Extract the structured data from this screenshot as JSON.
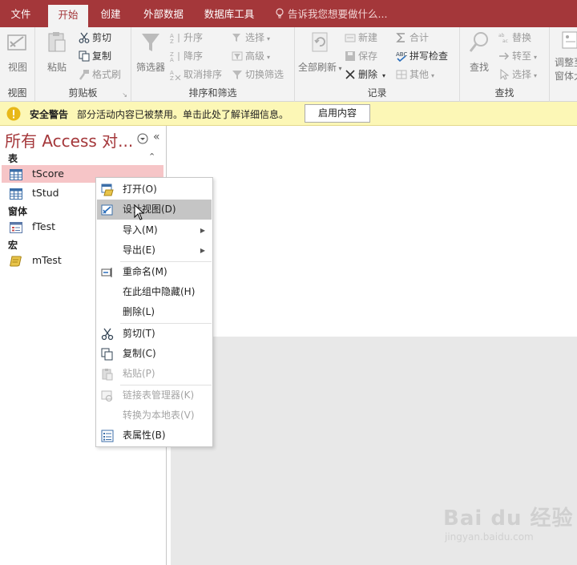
{
  "tabs": [
    "文件",
    "开始",
    "创建",
    "外部数据",
    "数据库工具"
  ],
  "tell_me": "告诉我您想要做什么...",
  "ribbon": {
    "views": {
      "view": "视图",
      "group": "视图"
    },
    "clipboard": {
      "paste": "粘贴",
      "cut": "剪切",
      "copy": "复制",
      "format_painter": "格式刷",
      "group": "剪贴板"
    },
    "sort": {
      "filter": "筛选器",
      "asc": "升序",
      "desc": "降序",
      "remove_sort": "取消排序",
      "selection": "选择",
      "advanced": "高级",
      "toggle_filter": "切换筛选",
      "group": "排序和筛选"
    },
    "records": {
      "refresh_all": "全部刷新",
      "new": "新建",
      "save": "保存",
      "delete": "删除",
      "totals": "合计",
      "spelling": "拼写检查",
      "more": "其他",
      "group": "记录"
    },
    "find": {
      "find": "查找",
      "replace": "替换",
      "goto": "转至",
      "select": "选择",
      "group": "查找"
    },
    "window": {
      "size_line1": "调整至",
      "size_line2": "窗体大小"
    }
  },
  "security": {
    "title": "安全警告",
    "message": "部分活动内容已被禁用。单击此处了解详细信息。",
    "button": "启用内容"
  },
  "nav": {
    "title": "所有 Access 对...",
    "groups": {
      "tables": "表",
      "forms": "窗体",
      "macros": "宏"
    },
    "items": {
      "tScore": "tScore",
      "tStud": "tStud",
      "fTest": "fTest",
      "mTest": "mTest"
    }
  },
  "context_menu": {
    "open": "打开(O)",
    "design_view": "设计视图(D)",
    "import": "导入(M)",
    "export": "导出(E)",
    "rename": "重命名(M)",
    "hide": "在此组中隐藏(H)",
    "delete": "删除(L)",
    "cut": "剪切(T)",
    "copy": "复制(C)",
    "paste": "粘贴(P)",
    "linked_table_manager": "链接表管理器(K)",
    "convert_local": "转换为本地表(V)",
    "table_properties": "表属性(B)"
  },
  "watermark": {
    "brand": "Bai du 经验",
    "url": "jingyan.baidu.com"
  },
  "colors": {
    "accent": "#a4373a",
    "selected": "#f6c5c7",
    "warning_bar": "#fcf7b6"
  }
}
